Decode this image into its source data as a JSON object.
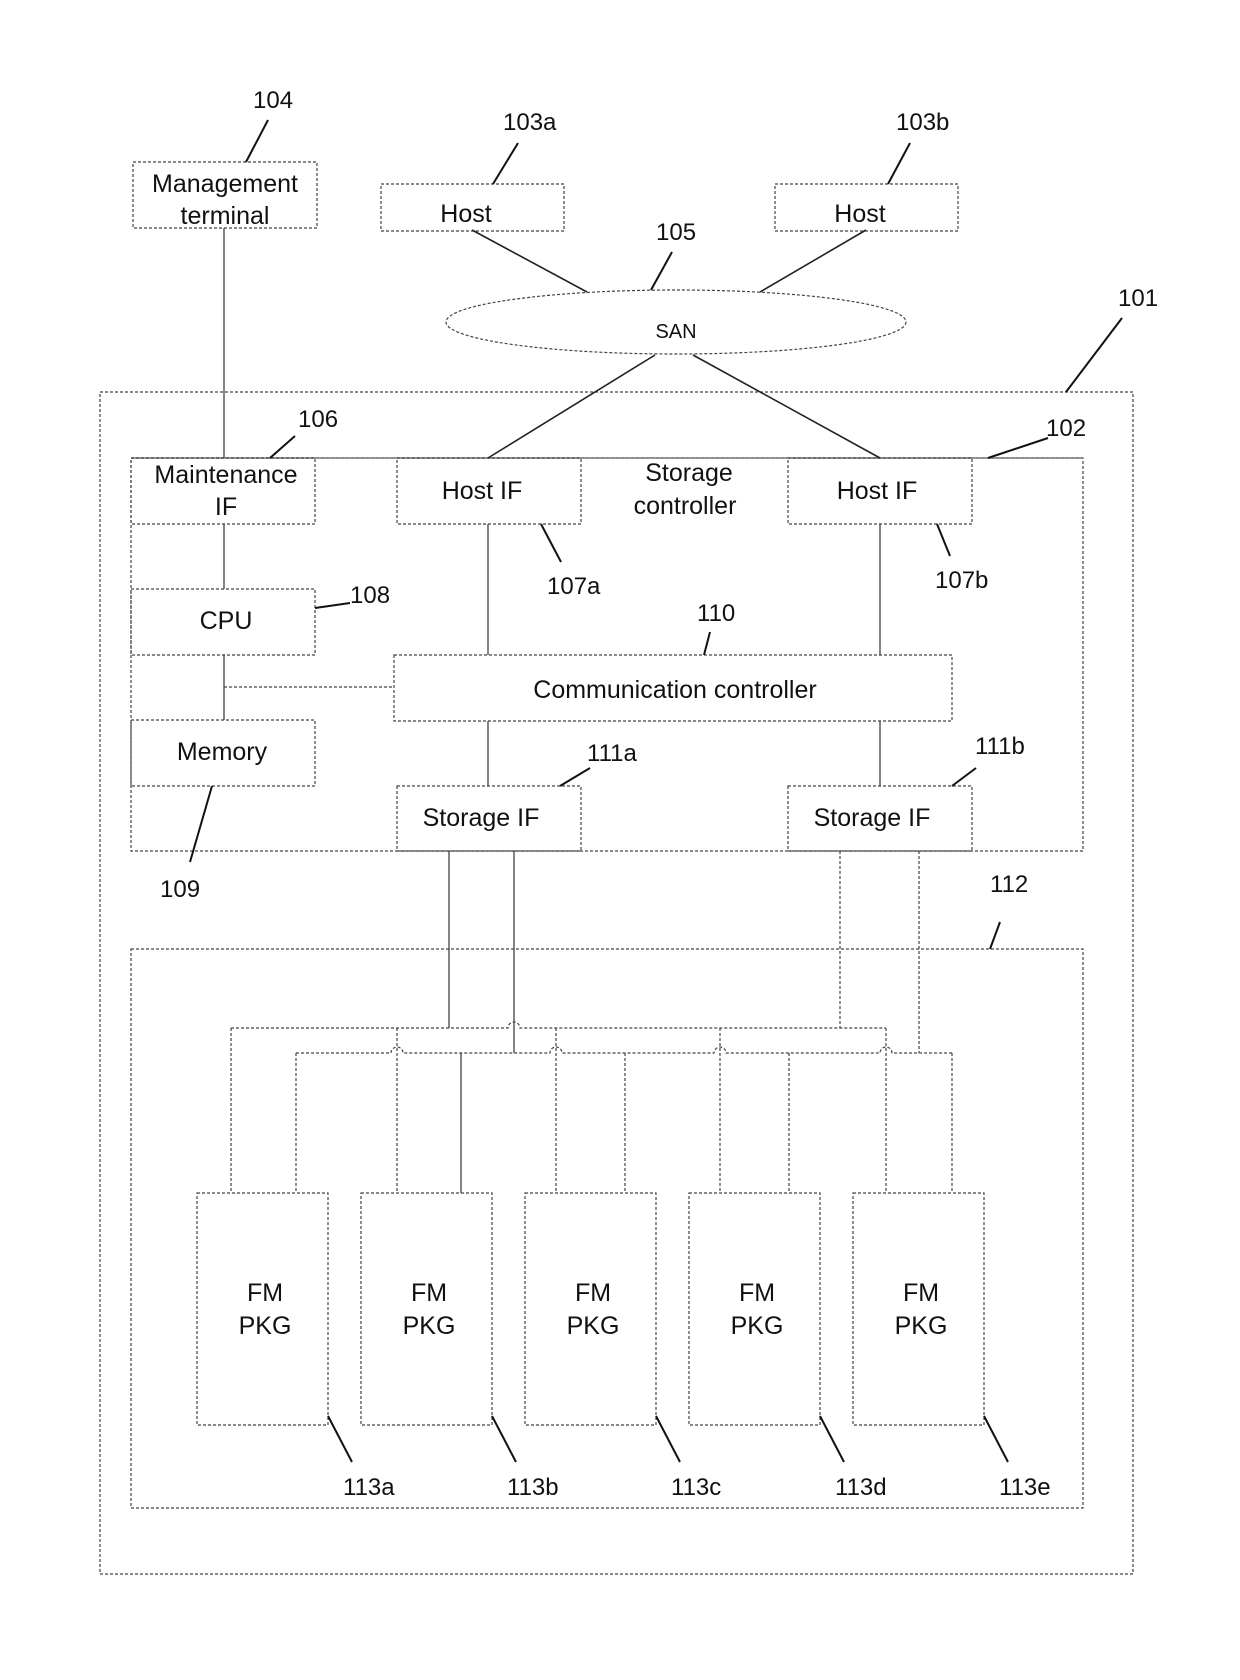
{
  "figure": {
    "management_terminal": {
      "ref": "104",
      "lines": [
        "Management",
        "terminal"
      ]
    },
    "hosts": [
      {
        "ref": "103a",
        "label": "Host"
      },
      {
        "ref": "103b",
        "label": "Host"
      }
    ],
    "san": {
      "ref": "105",
      "label": "SAN"
    },
    "storage_system": {
      "ref": "101"
    },
    "storage_controller": {
      "ref": "102",
      "lines": [
        "Storage",
        "controller"
      ]
    },
    "maintenance_if": {
      "ref": "106",
      "lines": [
        "Maintenance",
        "IF"
      ]
    },
    "host_ifs": [
      {
        "ref": "107a",
        "label": "Host IF"
      },
      {
        "ref": "107b",
        "label": "Host  IF"
      }
    ],
    "cpu": {
      "ref": "108",
      "label": "CPU"
    },
    "memory": {
      "ref": "109",
      "label": "Memory"
    },
    "communication_controller": {
      "ref": "110",
      "label": "Communication controller"
    },
    "storage_ifs": [
      {
        "ref": "111a",
        "label": "Storage  IF"
      },
      {
        "ref": "111b",
        "label": "Storage  IF"
      }
    ],
    "fm_area": {
      "ref": "112"
    },
    "fm_packages": [
      {
        "ref": "113a",
        "lines": [
          "FM",
          "PKG"
        ]
      },
      {
        "ref": "113b",
        "lines": [
          "FM",
          "PKG"
        ]
      },
      {
        "ref": "113c",
        "lines": [
          "FM",
          "PKG"
        ]
      },
      {
        "ref": "113d",
        "lines": [
          "FM",
          "PKG"
        ]
      },
      {
        "ref": "113e",
        "lines": [
          "FM",
          "PKG"
        ]
      }
    ]
  }
}
